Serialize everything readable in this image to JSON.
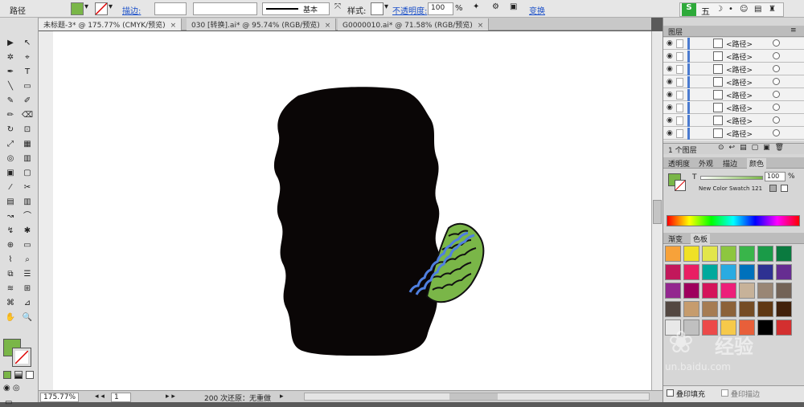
{
  "control_bar": {
    "object_type": "路径",
    "stroke_label": "描边:",
    "stroke_profile": "基本",
    "style_label": "样式:",
    "opacity_label": "不透明度:",
    "opacity_value": "100",
    "opacity_unit": "%",
    "transform_label": "变换",
    "fill_color": "#7ab648"
  },
  "ime_bar": {
    "logo": "S",
    "mode": "五"
  },
  "tabs": [
    {
      "label": "未标题-3* @ 175.77% (CMYK/预览)",
      "active": true
    },
    {
      "label": "030 [转换].ai* @ 95.74% (RGB/预览)",
      "active": false
    },
    {
      "label": "G0000010.ai* @ 71.58% (RGB/预览)",
      "active": false
    }
  ],
  "tab_close_glyph": "×",
  "tools": [
    "▶",
    "↖",
    "✲",
    "⌖",
    "✒",
    "T",
    "╲",
    "▭",
    "✎",
    "✐",
    "✏",
    "⌫",
    "↻",
    "⊡",
    "⤢",
    "▦",
    "◎",
    "▥",
    "▣",
    "▢",
    "⁄",
    "✂",
    "▤",
    "▥",
    "↝",
    "⌒",
    "↯",
    "✱",
    "⊕",
    "▭",
    "⌇",
    "⌕",
    "⧉",
    "☰",
    "≋",
    "⊞",
    "⌘",
    "⊿",
    "✋",
    "🔍"
  ],
  "layers_panel": {
    "title": "图层",
    "rows": [
      "<路径>",
      "<路径>",
      "<路径>",
      "<路径>",
      "<路径>",
      "<路径>",
      "<路径>",
      "<路径>"
    ],
    "footer": "1 个图层"
  },
  "color_panel": {
    "tabs": [
      "透明度",
      "外观",
      "描边",
      "颜色"
    ],
    "t_label": "T",
    "value": "100",
    "unit": "%",
    "swatch_name": "New Color Swatch 121"
  },
  "swatches_panel": {
    "tabs": [
      "渐变",
      "色板"
    ],
    "colors": [
      "#f7a23a",
      "#f0e126",
      "#e2e64a",
      "#8dc63f",
      "#39b54a",
      "#1a9b48",
      "#0a7a3f",
      "#c2185b",
      "#e91e63",
      "#00a99d",
      "#29abe2",
      "#0071bc",
      "#2e3192",
      "#662d91",
      "#93278f",
      "#9e005d",
      "#d4145a",
      "#ed1e79",
      "#c7b299",
      "#998675",
      "#736357",
      "#534741",
      "#c69c6d",
      "#a67c52",
      "#8c6239",
      "#754c24",
      "#603813",
      "#42210b",
      "#e8e8e8",
      "#c0c0c0",
      "#ec4a4a",
      "#f6c94a",
      "#e85f3a",
      "#000000",
      "#d32f2f"
    ],
    "watermark_text": "经验",
    "watermark_url": "un.baidu.com"
  },
  "bottom_panel": {
    "overprint_fill": "叠印填充",
    "overprint_stroke": "叠印描边"
  },
  "status": {
    "zoom": "175.77%",
    "page": "1",
    "undo": "200 次还原：无重做"
  }
}
